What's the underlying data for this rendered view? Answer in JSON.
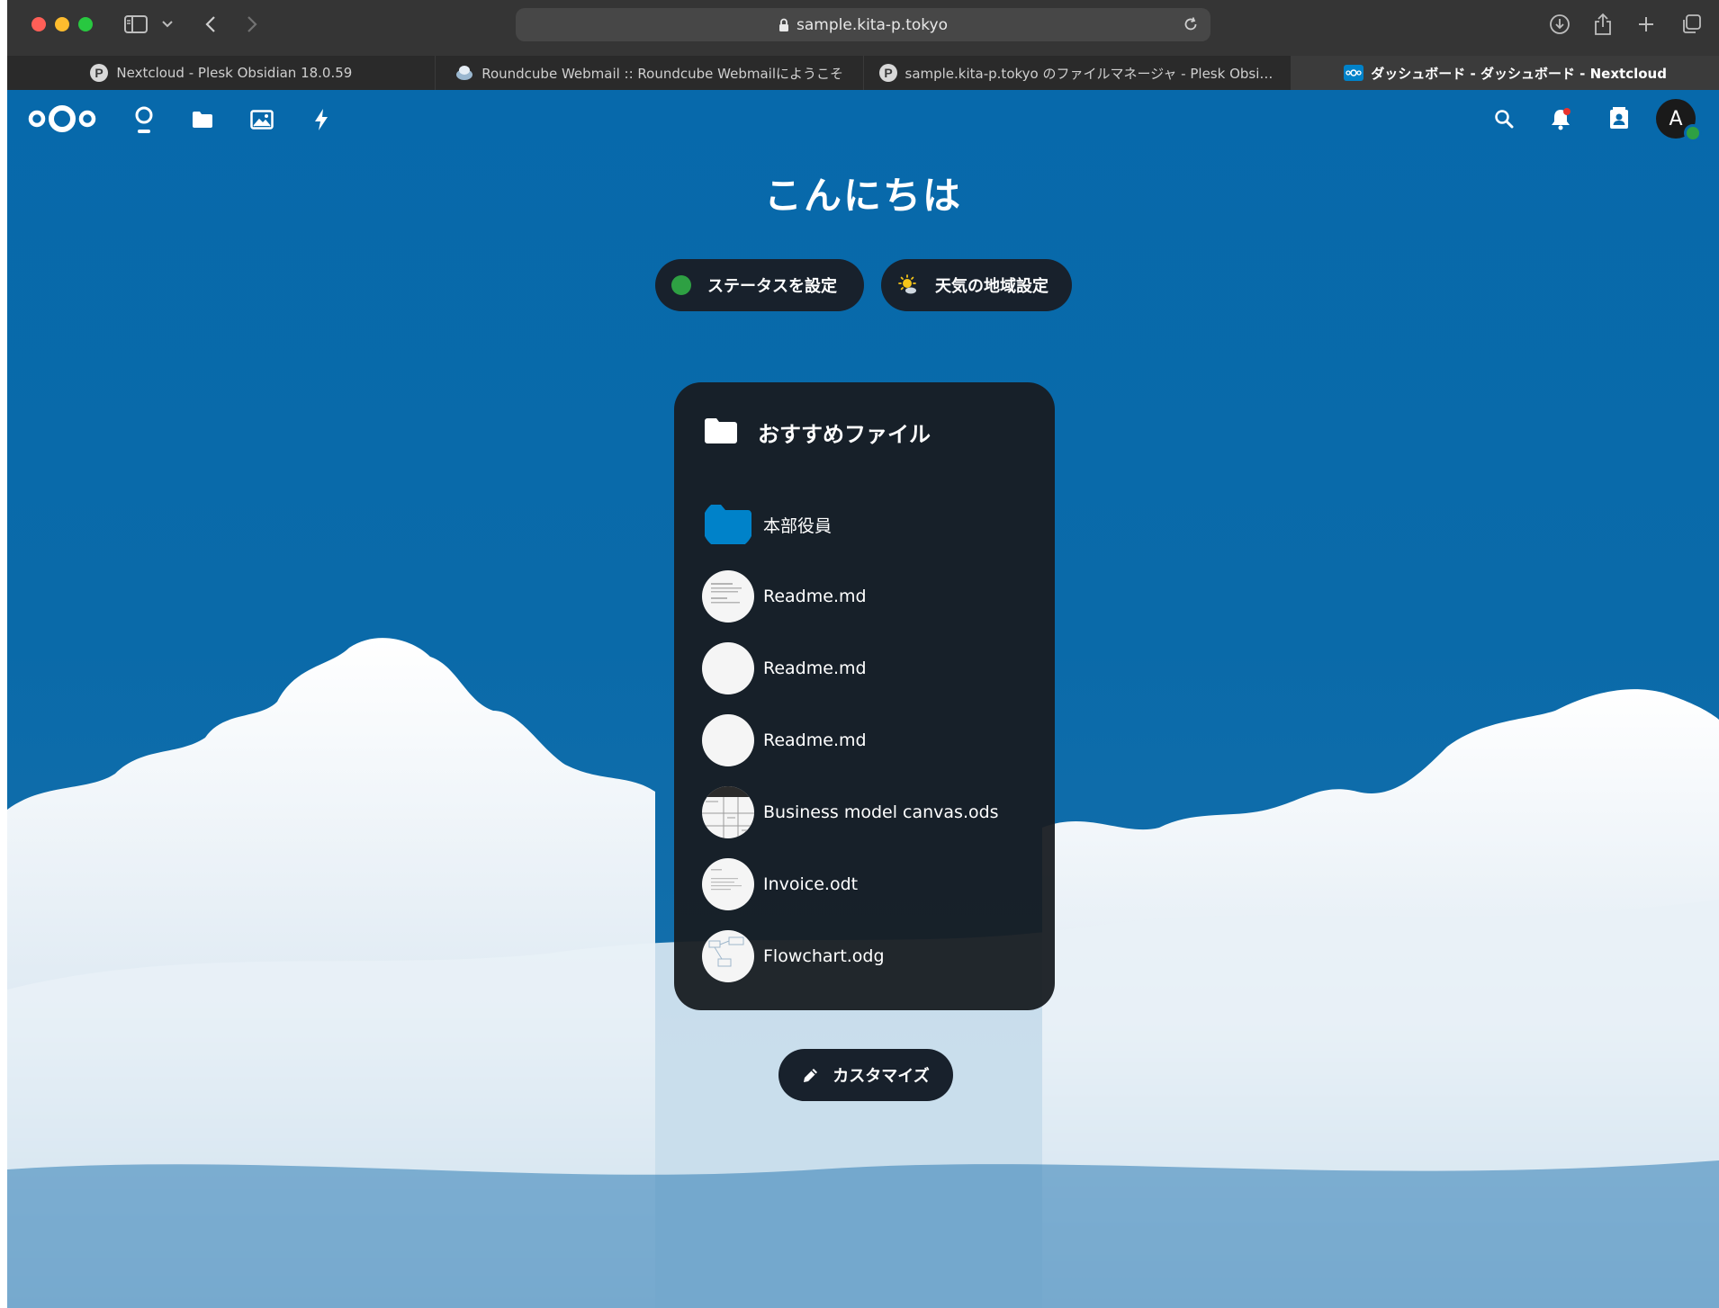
{
  "browser": {
    "url": "sample.kita-p.tokyo",
    "tabs": [
      {
        "title": "Nextcloud - Plesk Obsidian 18.0.59",
        "favicon": "plesk-icon",
        "active": false
      },
      {
        "title": "Roundcube Webmail :: Roundcube Webmailにようこそ",
        "favicon": "roundcube-icon",
        "active": false
      },
      {
        "title": "sample.kita-p.tokyo のファイルマネージャ - Plesk Obsidia...",
        "favicon": "plesk-icon",
        "active": false
      },
      {
        "title": "ダッシュボード - ダッシュボード - Nextcloud",
        "favicon": "nextcloud-icon",
        "active": true
      }
    ]
  },
  "header": {
    "apps": [
      "dashboard-icon",
      "files-icon",
      "photos-icon",
      "activity-icon"
    ],
    "right_icons": [
      "search-icon",
      "notifications-icon",
      "contacts-icon"
    ],
    "avatar_initial": "A",
    "avatar_status_color": "#2ea043"
  },
  "dashboard": {
    "greeting": "こんにちは",
    "status_button": "ステータスを設定",
    "weather_button": "天気の地域設定",
    "customize_button": "カスタマイズ"
  },
  "widget": {
    "title": "おすすめファイル",
    "files": [
      {
        "name": "本部役員",
        "kind": "folder"
      },
      {
        "name": "Readme.md",
        "kind": "document"
      },
      {
        "name": "Readme.md",
        "kind": "document"
      },
      {
        "name": "Readme.md",
        "kind": "document"
      },
      {
        "name": "Business model canvas.ods",
        "kind": "spreadsheet"
      },
      {
        "name": "Invoice.odt",
        "kind": "document"
      },
      {
        "name": "Flowchart.odg",
        "kind": "drawing"
      }
    ]
  },
  "colors": {
    "brand_blue": "#0769ab",
    "pill_bg": "#18212c",
    "folder_blue": "#0082c9"
  }
}
